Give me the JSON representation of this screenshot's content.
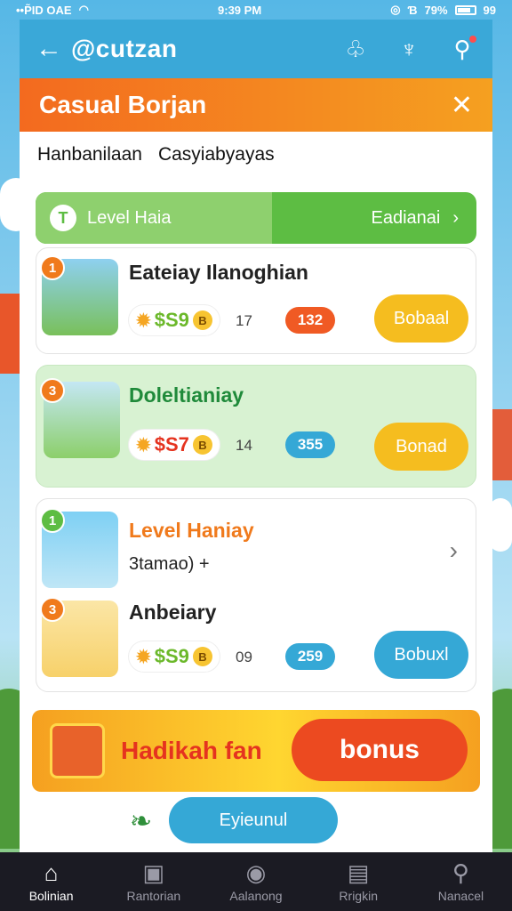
{
  "status": {
    "carrier": "••P̃ID OAE",
    "time": "9:39 PM",
    "battery": "79%",
    "right_extra": "99"
  },
  "appbar": {
    "brand": "@cutzan"
  },
  "dialog": {
    "title": "Casual Borjan",
    "subtitle_left": "Hanbanilaan",
    "subtitle_right": "Casyiabyayas",
    "level_left": "Level Haia",
    "level_right": "Eadianai"
  },
  "items": [
    {
      "badge": "1",
      "title": "Eateiay Ilanoghian",
      "coins": "$S9",
      "coin_letter": "B",
      "count": "17",
      "pill": "132",
      "button": "Bobaal"
    },
    {
      "badge": "3",
      "title": "Doleltianiay",
      "coins": "$S7",
      "coin_letter": "B",
      "count": "14",
      "pill": "355",
      "button": "Bonad"
    },
    {
      "badge": "1",
      "title": "Level Haniay",
      "sub": "3tamao) +",
      "badge2": "3",
      "title2": "Anbeiary",
      "coins": "$S9",
      "coin_letter": "B",
      "count": "09",
      "pill": "259",
      "button": "Bobuxl"
    }
  ],
  "promo": {
    "text": "Hadikah fan",
    "button": "bonus"
  },
  "footer": {
    "button": "Eyieunul"
  },
  "tabs": [
    {
      "label": "Bolinian",
      "icon": "home-icon",
      "active": true
    },
    {
      "label": "Rantorian",
      "icon": "bag-icon",
      "active": false
    },
    {
      "label": "Aalanong",
      "icon": "badge-icon",
      "active": false
    },
    {
      "label": "Rrigkin",
      "icon": "inbox-icon",
      "active": false
    },
    {
      "label": "Nanacel",
      "icon": "search-icon",
      "active": false
    }
  ],
  "colors": {
    "accent_orange": "#f36a1f",
    "accent_green": "#5dbd43",
    "accent_blue": "#35a8d6",
    "pill_red": "#f05a24"
  }
}
